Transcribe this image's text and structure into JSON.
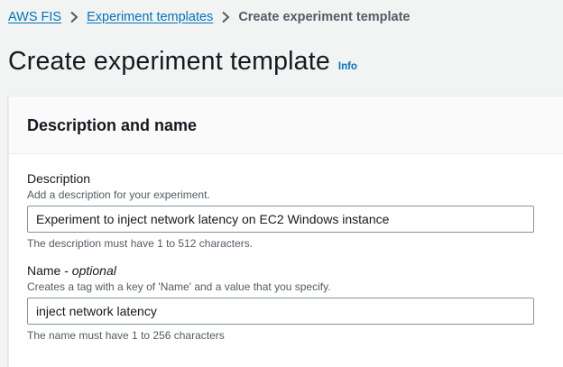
{
  "breadcrumb": {
    "items": [
      "AWS FIS",
      "Experiment templates"
    ],
    "current": "Create experiment template"
  },
  "header": {
    "title": "Create experiment template",
    "info_link": "Info"
  },
  "panel": {
    "title": "Description and name",
    "description_field": {
      "label": "Description",
      "help": "Add a description for your experiment.",
      "value": "Experiment to inject network latency on EC2 Windows instance",
      "constraint": "The description must have 1 to 512 characters."
    },
    "name_field": {
      "label": "Name - ",
      "label_optional": "optional",
      "help": "Creates a tag with a key of 'Name' and a value that you specify.",
      "value": "inject network latency",
      "constraint": "The name must have 1 to 256 characters"
    }
  },
  "icons": {
    "breadcrumb_separator": "chevron-right-icon"
  },
  "colors": {
    "link": "#0073bb",
    "text": "#16191f",
    "secondary_text": "#545b64",
    "page_background": "#f2f3f3"
  }
}
